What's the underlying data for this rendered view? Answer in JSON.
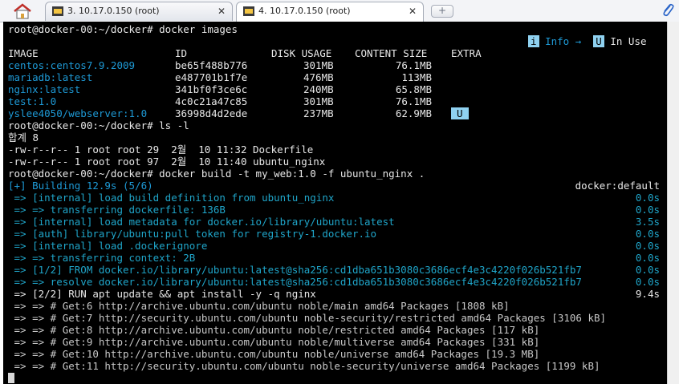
{
  "tabs": [
    {
      "title": "3. 10.17.0.150 (root)",
      "close": "✕"
    },
    {
      "title": "4. 10.17.0.150 (root)",
      "close": "✕"
    }
  ],
  "newtab_label": "+",
  "terminal": {
    "prompt1": "root@docker-00:~/docker# docker images",
    "legend": {
      "i": "i",
      "info": "Info →",
      "u": "U",
      "in_use": "In Use"
    },
    "images_header": {
      "image": "IMAGE",
      "id": "ID",
      "disk": "DISK USAGE",
      "content": "CONTENT SIZE",
      "extra": "EXTRA"
    },
    "images": [
      {
        "image": "centos:centos7.9.2009",
        "id": "be65f488b776",
        "disk": "301MB",
        "content": "76.1MB",
        "extra": ""
      },
      {
        "image": "mariadb:latest",
        "id": "e487701b1f7e",
        "disk": "476MB",
        "content": "113MB",
        "extra": ""
      },
      {
        "image": "nginx:latest",
        "id": "341bf0f3ce6c",
        "disk": "240MB",
        "content": "65.8MB",
        "extra": ""
      },
      {
        "image": "test:1.0",
        "id": "4c0c21a47c85",
        "disk": "301MB",
        "content": "76.1MB",
        "extra": ""
      },
      {
        "image": "yslee4050/webserver:1.0",
        "id": "36998d4d2ede",
        "disk": "237MB",
        "content": "62.9MB",
        "extra": "U"
      }
    ],
    "prompt2": "root@docker-00:~/docker# ls -l",
    "total": "합계 8",
    "ls": [
      "-rw-r--r-- 1 root root 29  2월  10 11:32 Dockerfile",
      "-rw-r--r-- 1 root root 97  2월  10 11:40 ubuntu_nginx"
    ],
    "prompt3": "root@docker-00:~/docker# docker build -t my_web:1.0 -f ubuntu_nginx .",
    "building": {
      "text": "[+] Building 12.9s (5/6)",
      "right": "docker:default"
    },
    "steps": [
      {
        "text": " => [internal] load build definition from ubuntu_nginx",
        "time": "0.0s"
      },
      {
        "text": " => => transferring dockerfile: 136B",
        "time": "0.0s"
      },
      {
        "text": " => [internal] load metadata for docker.io/library/ubuntu:latest",
        "time": "3.5s"
      },
      {
        "text": " => [auth] library/ubuntu:pull token for registry-1.docker.io",
        "time": "0.0s"
      },
      {
        "text": " => [internal] load .dockerignore",
        "time": "0.0s"
      },
      {
        "text": " => => transferring context: 2B",
        "time": "0.0s"
      },
      {
        "text": " => [1/2] FROM docker.io/library/ubuntu:latest@sha256:cd1dba651b3080c3686ecf4e3c4220f026b521fb7",
        "time": "0.0s"
      },
      {
        "text": " => => resolve docker.io/library/ubuntu:latest@sha256:cd1dba651b3080c3686ecf4e3c4220f026b521fb7",
        "time": "0.0s"
      }
    ],
    "run_step": {
      "text": " => [2/2] RUN apt update && apt install -y -q nginx",
      "time": "9.4s"
    },
    "run_lines": [
      " => => # Get:6 http://archive.ubuntu.com/ubuntu noble/main amd64 Packages [1808 kB]",
      " => => # Get:7 http://security.ubuntu.com/ubuntu noble-security/restricted amd64 Packages [3106 kB]",
      " => => # Get:8 http://archive.ubuntu.com/ubuntu noble/restricted amd64 Packages [117 kB]",
      " => => # Get:9 http://archive.ubuntu.com/ubuntu noble/multiverse amd64 Packages [331 kB]",
      " => => # Get:10 http://archive.ubuntu.com/ubuntu noble/universe amd64 Packages [19.3 MB]",
      " => => # Get:11 http://security.ubuntu.com/ubuntu noble-security/universe amd64 Packages [1199 kB]"
    ]
  },
  "colors": {
    "terminal_bg": "#000000",
    "text": "#d8d8d8",
    "accent": "#1e9ad6",
    "badge": "#8fd1f0"
  },
  "icons": {
    "home": "home-icon",
    "terminal": "terminal-tab-icon",
    "attach": "paperclip-icon"
  }
}
